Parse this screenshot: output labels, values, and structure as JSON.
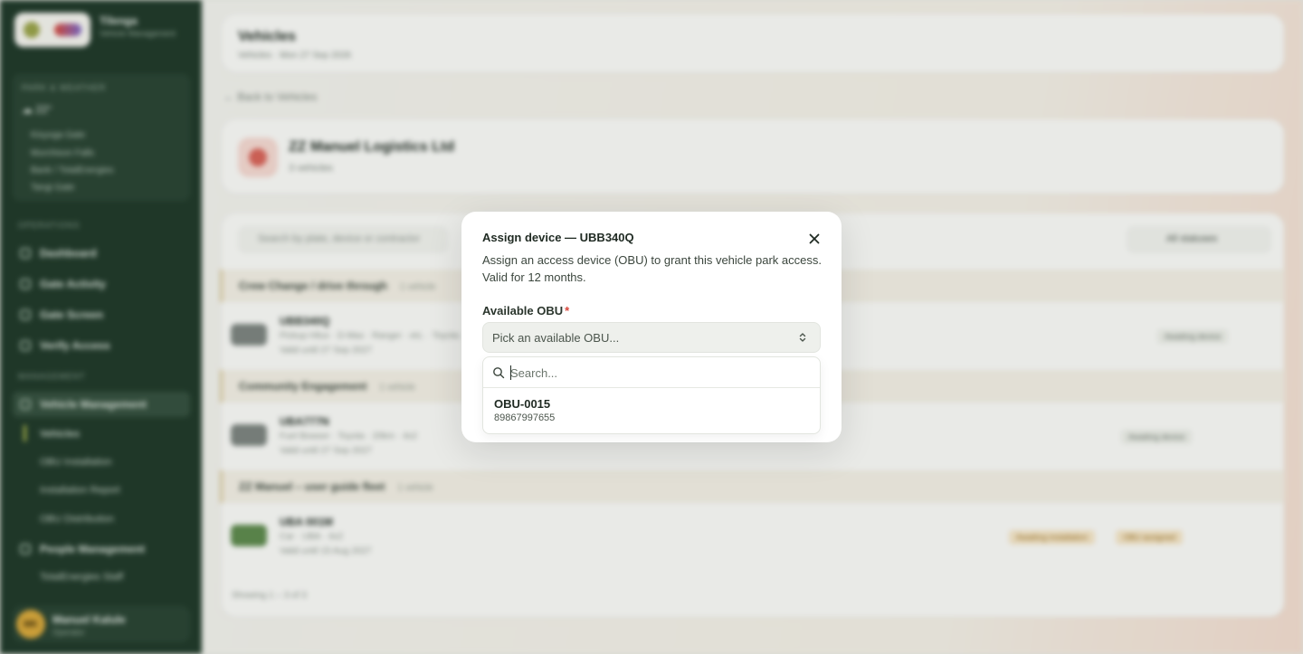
{
  "sidebar": {
    "brand_name": "Tilenga",
    "brand_sub": "Vehicle Management",
    "park_title": "PARK & WEATHER",
    "park_weather": "☁ 22°",
    "park_lines": [
      "Kisyoga Gate",
      "Murchison Falls",
      "Bank / TotalEnergies",
      "Tangi Gate"
    ],
    "section_operations": "OPERATIONS",
    "nav_operations": [
      "Dashboard",
      "Gate Activity",
      "Gate Screen",
      "Verify Access"
    ],
    "section_management": "MANAGEMENT",
    "nav_vehicle_mgmt": "Vehicle Management",
    "sub_vehicle": [
      "Vehicles",
      "OBU Installation",
      "Installation Report",
      "OBU Distribution"
    ],
    "nav_people": "People Management",
    "sub_people": [
      "TotalEnergies Staff"
    ],
    "user_initials": "MK",
    "user_name": "Manuel Kalule",
    "user_role": "Operator"
  },
  "main": {
    "page_title": "Vehicles",
    "page_sub": "Vehicles · Mon 27 Sep 2026",
    "back_link": "← Back to Vehicles",
    "org_name": "ZZ Manuel Logistics Ltd",
    "org_count": "3 vehicles",
    "search_placeholder": "Search by plate, device or contractor",
    "filter_label": "All statuses",
    "groups": [
      {
        "name": "Crew Change / drive through",
        "count": "1 vehicle"
      },
      {
        "name": "Community Engagement",
        "count": "1 vehicle"
      },
      {
        "name": "ZZ Manuel – user guide fleet",
        "count": "1 vehicle"
      }
    ],
    "vehicles": [
      {
        "plate": "UBB340Q",
        "desc": "Pickup Hilux · D-Max · Ranger · etc. · Toyota",
        "valid": "Valid until 27 Sep 2027",
        "status": "Awaiting device"
      },
      {
        "plate": "UBA777N",
        "desc": "Fuel Bowser · Toyota · 20km · 4x2",
        "valid": "Valid until 27 Sep 2027",
        "status": "Awaiting device"
      },
      {
        "plate": "UBA 001M",
        "desc": "Car · UBA · 4x2",
        "valid": "Valid until 15 Aug 2027",
        "status": "Awaiting installation",
        "status2": "OBU assigned"
      }
    ],
    "footer": "Showing 1 – 3 of 3"
  },
  "modal": {
    "title": "Assign device — UBB340Q",
    "description": "Assign an access device (OBU) to grant this vehicle park access. Valid for 12 months.",
    "field_label": "Available OBU",
    "required_mark": "*",
    "select_placeholder": "Pick an available OBU...",
    "search_placeholder": "Search...",
    "options": [
      {
        "title": "OBU-0015",
        "subtitle": "89867997655"
      }
    ]
  },
  "icons": {
    "close": "close-icon",
    "chevron": "chevron-up-down-icon",
    "search": "search-icon"
  }
}
